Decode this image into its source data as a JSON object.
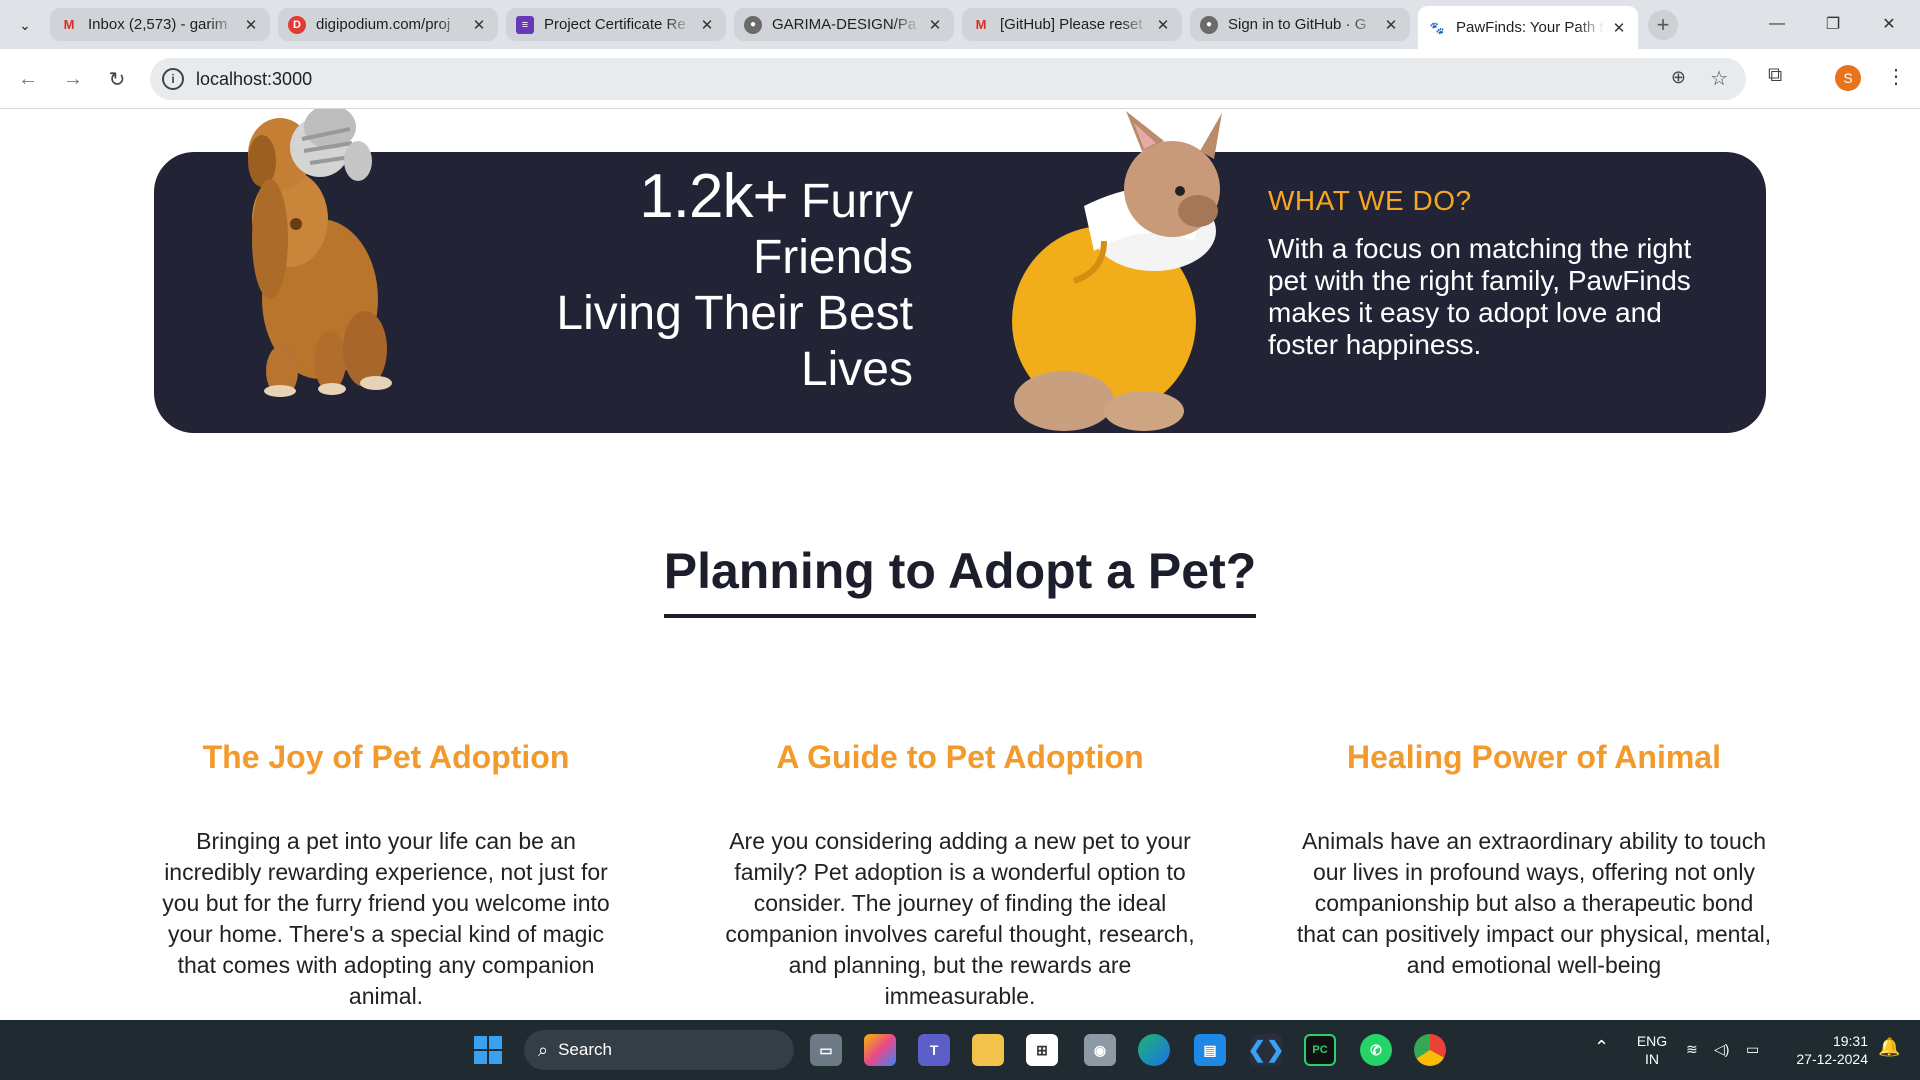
{
  "browser": {
    "tabs": [
      {
        "title": "Inbox (2,573) - garim",
        "favicon": "gmail-icon",
        "color": "#d93025"
      },
      {
        "title": "digipodium.com/proj",
        "favicon": "digipodium-icon",
        "color": "#e53935"
      },
      {
        "title": "Project Certificate Re",
        "favicon": "form-icon",
        "color": "#673ab7"
      },
      {
        "title": "GARIMA-DESIGN/Pa",
        "favicon": "github-icon",
        "color": "#24292f"
      },
      {
        "title": "[GitHub] Please reset",
        "favicon": "gmail-icon",
        "color": "#d93025"
      },
      {
        "title": "Sign in to GitHub · G",
        "favicon": "github-icon",
        "color": "#24292f"
      },
      {
        "title": "PawFinds: Your Path t",
        "favicon": "paw-icon",
        "color": "#8a6d3b",
        "active": true
      }
    ],
    "url": "localhost:3000",
    "profile_initial": "S"
  },
  "banner": {
    "stat_number": "1.2k+",
    "stat_line1": "Furry",
    "stat_line2": "Friends",
    "stat_line3": "Living Their Best",
    "stat_line4": "Lives",
    "what_we_do_title": "WHAT WE DO?",
    "what_we_do_text": "With a focus on matching the right pet with the right family, PawFinds makes it easy to adopt love and foster happiness."
  },
  "section": {
    "heading": "Planning to Adopt a Pet?"
  },
  "columns": [
    {
      "title": "The Joy of Pet Adoption",
      "text": "Bringing a pet into your life can be an incredibly rewarding experience, not just for you but for the furry friend you welcome into your home. There's a special kind of magic that comes with adopting any companion animal."
    },
    {
      "title": "A Guide to Pet Adoption",
      "text": "Are you considering adding a new pet to your family? Pet adoption is a wonderful option to consider. The journey of finding the ideal companion involves careful thought, research, and planning, but the rewards are immeasurable."
    },
    {
      "title": "Healing Power of Animal",
      "text": "Animals have an extraordinary ability to touch our lives in profound ways, offering not only companionship but also a therapeutic bond that can positively impact our physical, mental, and emotional well-being"
    }
  ],
  "taskbar": {
    "search_label": "Search",
    "lang_line1": "ENG",
    "lang_line2": "IN",
    "time": "19:31",
    "date": "27-12-2024"
  },
  "colors": {
    "banner_bg": "#222334",
    "accent_orange": "#f39a2c",
    "heading_dark": "#1c1f2b"
  }
}
